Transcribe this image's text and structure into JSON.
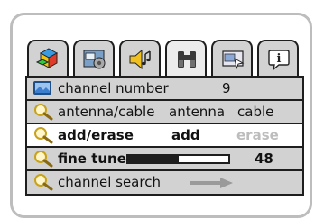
{
  "tabs": [
    {
      "icon": "color-blocks-icon",
      "active": false
    },
    {
      "icon": "settings-panel-icon",
      "active": false
    },
    {
      "icon": "speaker-music-icon",
      "active": false
    },
    {
      "icon": "binoculars-icon",
      "active": true
    },
    {
      "icon": "screen-window-icon",
      "active": false
    },
    {
      "icon": "info-icon",
      "active": false
    }
  ],
  "menu": {
    "channel_number": {
      "label": "channel number",
      "value": "9",
      "icon": "tv-screen-icon"
    },
    "antenna_cable": {
      "label": "antenna/cable",
      "option_1": "antenna",
      "option_2": "cable",
      "icon": "magnifier-icon"
    },
    "add_erase": {
      "label": "add/erase",
      "option_1": "add",
      "option_2": "erase",
      "icon": "magnifier-icon",
      "selected_option": "add"
    },
    "fine_tune": {
      "label": "fine tune",
      "value": "48",
      "level_fraction": 0.5,
      "icon": "magnifier-icon"
    },
    "channel_search": {
      "label": "channel search",
      "icon": "magnifier-icon",
      "action_icon": "right-arrow-icon"
    }
  },
  "colors": {
    "frame_border": "#bdbdbd",
    "menu_background": "#d2d2d2",
    "selected_row": "#ffffff",
    "disabled_text": "#bdbdbd",
    "outline": "#1e1e1e"
  }
}
